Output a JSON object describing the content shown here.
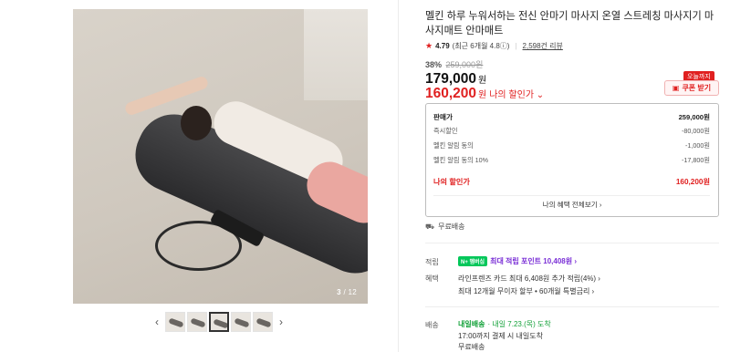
{
  "gallery": {
    "counter_current": "3",
    "counter_sep": " / ",
    "counter_total": "12",
    "prev_icon": "‹",
    "next_icon": "›"
  },
  "product": {
    "title": "멜킨 하루 누워서하는 전신 안마기 마사지 온열 스트레칭 마사지기 마사지매트 안마매트",
    "rating_score": "4.79",
    "rating_recent": "(최근 6개월 4.8ⓘ)",
    "review_count": "2,598건 리뷰",
    "discount_pct": "38%",
    "original_price": "259,000원",
    "price": "179,000",
    "price_unit": "원",
    "my_price": "160,200",
    "my_price_unit": "원",
    "my_price_label": "나의 할인가 ⌄"
  },
  "coupon": {
    "badge": "오늘까지",
    "button_label": "쿠폰 받기"
  },
  "price_breakdown": {
    "rows": [
      {
        "label": "판매가",
        "value": "259,000원"
      },
      {
        "label": "즉시할인",
        "value": "-80,000원"
      },
      {
        "label": "멜킨 알림 동의",
        "value": "-1,000원"
      },
      {
        "label": "멜킨 알림 동의 10%",
        "value": "-17,800원"
      }
    ],
    "my_price_label": "나의 할인가",
    "my_price_value": "160,200원",
    "all_benefits_link": "나의 혜택 전체보기 ›"
  },
  "no_charge": "무료배송",
  "points": {
    "label": "적립",
    "badge": "N+ 멤버십",
    "text": "최대 적립 포인트 10,408원 ›"
  },
  "benefit": {
    "label": "혜택",
    "line1": "라인프렌즈 카드 최대 6,408원 추가 적립(4%) ›",
    "line2": "최대 12개월 무이자 할부 • 60개월 특별금리 ›"
  },
  "shipping": {
    "label": "배송",
    "badge": "내일배송",
    "arrival": "· 내일 7.23.(목) 도착",
    "line2": "17:00까지 결제 시 내일도착",
    "line3": "무료배송"
  },
  "colors": {
    "accent_red": "#e02020",
    "npay_green": "#03c75a",
    "delivery_green": "#14a23a"
  }
}
